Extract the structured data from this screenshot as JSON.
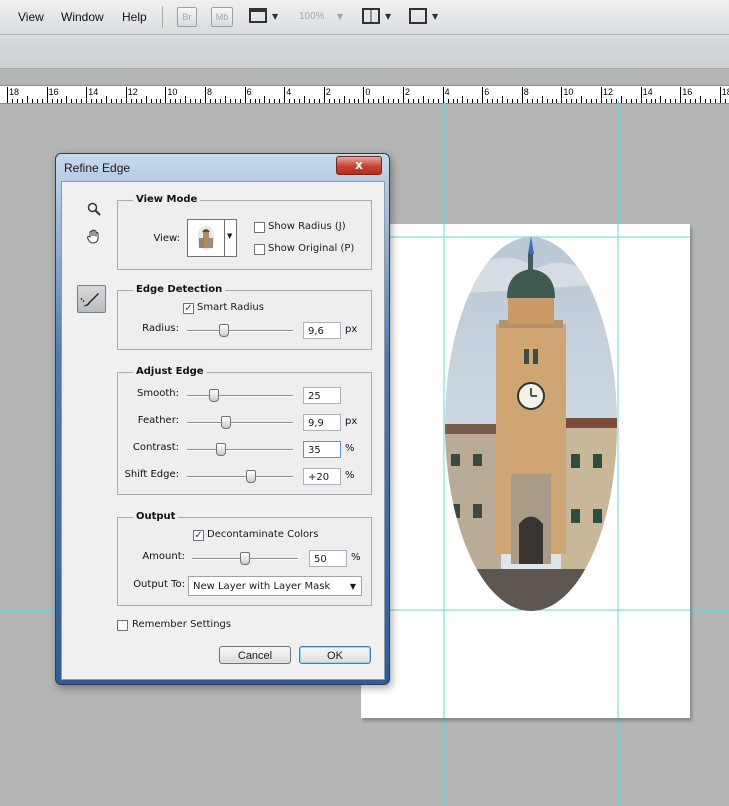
{
  "menubar": {
    "items": [
      "View",
      "Window",
      "Help"
    ],
    "buttons": {
      "br": "Br",
      "mb": "Mb"
    },
    "zoom": "100%"
  },
  "ruler": {
    "labels": [
      "18",
      "16",
      "14",
      "12",
      "10",
      "8",
      "6",
      "4",
      "2",
      "0",
      "2",
      "4",
      "6",
      "8",
      "10",
      "12",
      "14",
      "16",
      "18"
    ]
  },
  "dialog": {
    "title": "Refine Edge",
    "close_symbol": "x",
    "view_mode": {
      "title": "View Mode",
      "view_label": "View:",
      "show_radius": {
        "label": "Show Radius (J)",
        "checked": false
      },
      "show_original": {
        "label": "Show Original (P)",
        "checked": false
      }
    },
    "edge_detection": {
      "title": "Edge Detection",
      "smart_radius": {
        "label": "Smart Radius",
        "checked": true
      },
      "radius": {
        "label": "Radius:",
        "value": "9,6",
        "unit": "px",
        "level": 0.35
      }
    },
    "adjust_edge": {
      "title": "Adjust Edge",
      "smooth": {
        "label": "Smooth:",
        "value": "25",
        "unit": "",
        "level": 0.25
      },
      "feather": {
        "label": "Feather:",
        "value": "9,9",
        "unit": "px",
        "level": 0.37
      },
      "contrast": {
        "label": "Contrast:",
        "value": "35",
        "unit": "%",
        "level": 0.32
      },
      "shift_edge": {
        "label": "Shift Edge:",
        "value": "+20",
        "unit": "%",
        "level": 0.6
      }
    },
    "output": {
      "title": "Output",
      "decontaminate": {
        "label": "Decontaminate Colors",
        "checked": true
      },
      "amount": {
        "label": "Amount:",
        "value": "50",
        "unit": "%",
        "level": 0.5
      },
      "output_to_label": "Output To:",
      "output_to_value": "New Layer with Layer Mask"
    },
    "remember": {
      "label": "Remember Settings",
      "checked": false
    },
    "cancel_label": "Cancel",
    "ok_label": "OK"
  },
  "colors": {
    "guide": "#6fd1d6",
    "accent": "#2f5d99"
  }
}
